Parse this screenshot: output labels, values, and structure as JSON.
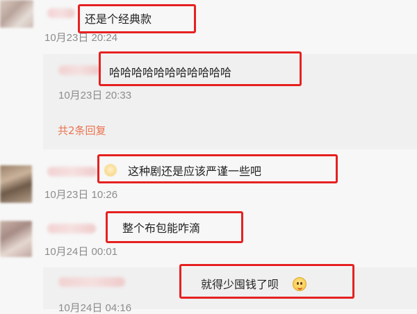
{
  "comments": [
    {
      "text": "还是个经典款",
      "time": "10月23日 20:24"
    },
    {
      "text": "这种剧还是应该严谨一些吧",
      "time": "10月23日 10:26"
    },
    {
      "text": "整个布包能咋滴",
      "time": "10月24日 00:01"
    }
  ],
  "replies": [
    {
      "text": "哈哈哈哈哈哈哈哈哈哈哈",
      "time": "10月23日 20:33",
      "more": "共2条回复"
    },
    {
      "text": "就得少囤钱了呗",
      "time": "10月24日 04:16"
    }
  ],
  "colors": {
    "annotation": "#e62121",
    "more_link": "#eb7350",
    "timestamp": "#8c8c8c"
  }
}
